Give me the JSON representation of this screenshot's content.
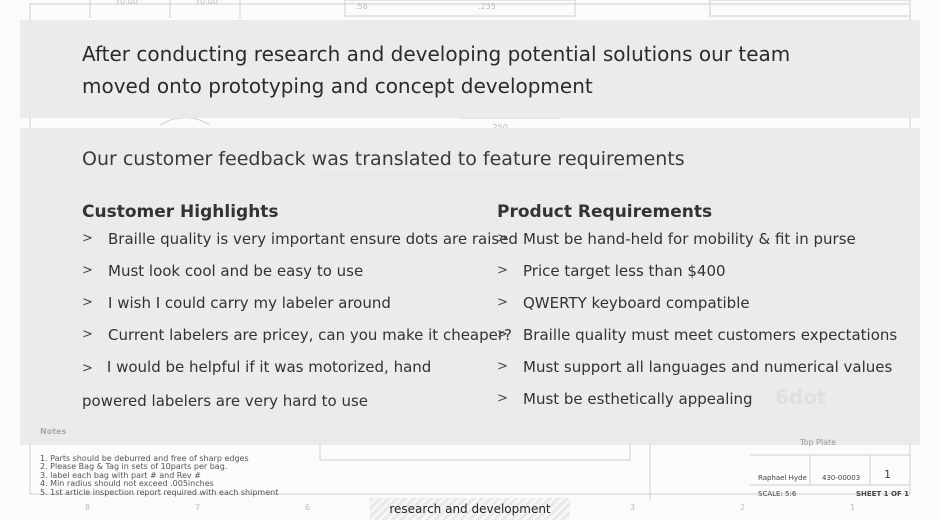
{
  "headline": "After conducting research and developing potential solutions our team moved onto prototyping and concept development",
  "subheading": "Our customer feedback was translated to feature requirements",
  "bullet_glyph": ">",
  "customer_highlights": {
    "title": "Customer Highlights",
    "items": [
      "Braille quality is very important ensure dots are raised",
      "Must look cool and be easy to use",
      "I wish I could carry my labeler around",
      "Current labelers are pricey, can you make it cheaper?",
      "I would be helpful if it was motorized, hand powered labelers are very hard to use"
    ]
  },
  "product_requirements": {
    "title": "Product Requirements",
    "items": [
      "Must be hand-held for mobility & fit in purse",
      "Price target less than $400",
      "QWERTY keyboard compatible",
      "Braille quality must meet customers expectations",
      "Must support all languages and numerical values",
      "Must be esthetically appealing"
    ]
  },
  "caption": "research and development",
  "drawing": {
    "notes_title": "Notes",
    "notes": [
      "1.   Parts should be deburred and free of sharp edges",
      "2.   Please Bag & Tag in sets of 10parts per bag.",
      "3.   label each bag with part # and Rev #",
      "4.   Min radius should not exceed .005inches",
      "5.   1st article inspection report required with each shipment"
    ],
    "company": "6dot",
    "part_name": "Top Plate",
    "drawn_by": "Raphael Hyde",
    "dwg_no": "430-00003",
    "rev": "1",
    "scale": "SCALE: 5:6",
    "sheet": "SHEET 1 OF 1"
  }
}
